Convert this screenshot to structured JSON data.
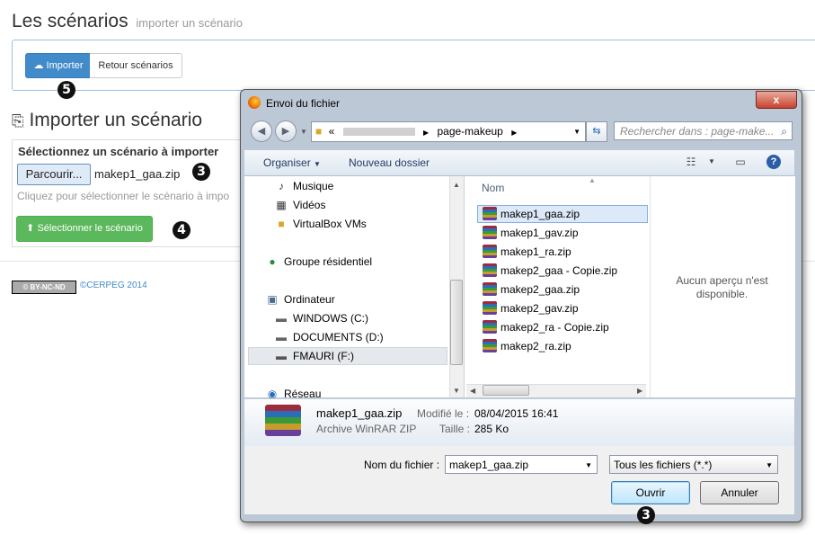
{
  "page": {
    "title": "Les scénarios",
    "subtitle": "importer un scénario",
    "btn_import": "Importer",
    "btn_back": "Retour scénarios",
    "section_title": "Importer un scénario",
    "panel_title": "Sélectionnez un scénario à importer",
    "browse_label": "Parcourir...",
    "selected_file": "makep1_gaa.zip",
    "help_text": "Cliquez pour sélectionner le scénario à impo",
    "select_btn": "Sélectionner le scénario",
    "cc_badge": "BY-NC-ND",
    "copyright": "©CERPEG 2014",
    "markers": [
      "5",
      "3",
      "4",
      "3"
    ]
  },
  "dialog": {
    "title": "Envoi du fichier",
    "close_label": "x",
    "address": {
      "prefix": "«",
      "folder": "page-makeup"
    },
    "search_placeholder": "Rechercher dans : page-make...",
    "toolbar": {
      "organize": "Organiser",
      "new_folder": "Nouveau dossier"
    },
    "tree": [
      {
        "label": "Musique",
        "icon": "music-icon"
      },
      {
        "label": "Vidéos",
        "icon": "video-icon"
      },
      {
        "label": "VirtualBox VMs",
        "icon": "folder-icon"
      },
      {
        "label": "Groupe résidentiel",
        "icon": "homegroup-icon"
      },
      {
        "label": "Ordinateur",
        "icon": "computer-icon"
      },
      {
        "label": "WINDOWS (C:)",
        "icon": "drive-icon"
      },
      {
        "label": "DOCUMENTS (D:)",
        "icon": "drive-icon"
      },
      {
        "label": "FMAURI (F:)",
        "icon": "usb-drive-icon"
      },
      {
        "label": "Réseau",
        "icon": "network-icon"
      }
    ],
    "column_header": "Nom",
    "files": [
      "makep1_gaa.zip",
      "makep1_gav.zip",
      "makep1_ra.zip",
      "makep2_gaa - Copie.zip",
      "makep2_gaa.zip",
      "makep2_gav.zip",
      "makep2_ra - Copie.zip",
      "makep2_ra.zip"
    ],
    "preview_text": "Aucun aperçu n'est disponible.",
    "details": {
      "name": "makep1_gaa.zip",
      "type": "Archive WinRAR ZIP",
      "modified_label": "Modifié le :",
      "modified_value": "08/04/2015 16:41",
      "size_label": "Taille :",
      "size_value": "285 Ko"
    },
    "filename_label": "Nom du fichier :",
    "filename_value": "makep1_gaa.zip",
    "filter_value": "Tous les fichiers (*.*)",
    "open_label": "Ouvrir",
    "cancel_label": "Annuler"
  },
  "colors": {
    "primary": "#428bca",
    "success": "#5cb85c",
    "dialog_frame": "#bcc8d6"
  }
}
